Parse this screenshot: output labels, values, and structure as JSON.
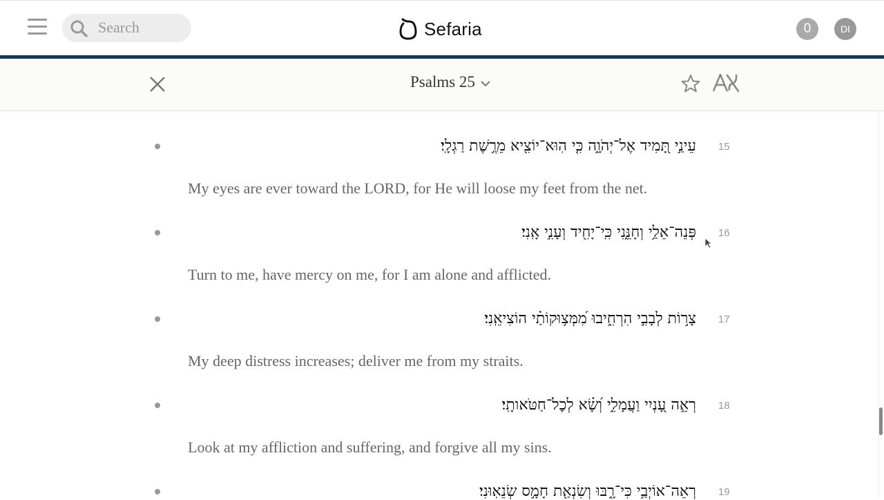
{
  "header": {
    "search_placeholder": "Search",
    "logo_text": "Sefaria",
    "notifications_count": "0",
    "avatar_initials": "DI",
    "rule_color": "#18345d"
  },
  "reader": {
    "title": "Psalms 25",
    "verses": [
      {
        "num": "15",
        "he": "עֵינַ֣י תָּ֭מִיד אֶל־יְהֹוָ֑ה כִּ֤י הֽוּא־יוֹצִ֖יא מֵרֶ֣שֶׁת רַגְלָֽי׃",
        "en": "My eyes are ever toward the LORD, for He will loose my feet from the net."
      },
      {
        "num": "16",
        "he": "פְּנֵה־אֵלַ֥י וְחָנֵּ֑נִי כִּֽי־יָחִ֖יד וְעָנִ֣י אָֽנִי׃",
        "en": "Turn to me, have mercy on me, for I am alone and afflicted."
      },
      {
        "num": "17",
        "he": "צָר֣וֹת לְבָבִ֣י הִרְחִ֑יבוּ מִ֝מְּצ֥וּקוֹתַ֗י הוֹצִיאֵֽנִי׃",
        "en": "My deep distress increases; deliver me from my straits."
      },
      {
        "num": "18",
        "he": "רְאֵ֣ה עָ֭נְיִי וַעֲמָלִ֑י וְ֝שָׂ֗א לְכׇל־חַטֹּאותָֽי׃",
        "en": "Look at my affliction and suffering, and forgive all my sins."
      },
      {
        "num": "19",
        "he": "רְאֵה־אוֹיְבַ֥י כִּי־רָ֑בּוּ וְשִׂנְאַ֖ת חָמָ֣ס שְׂנֵאֽוּנִי׃",
        "en": ""
      }
    ]
  }
}
